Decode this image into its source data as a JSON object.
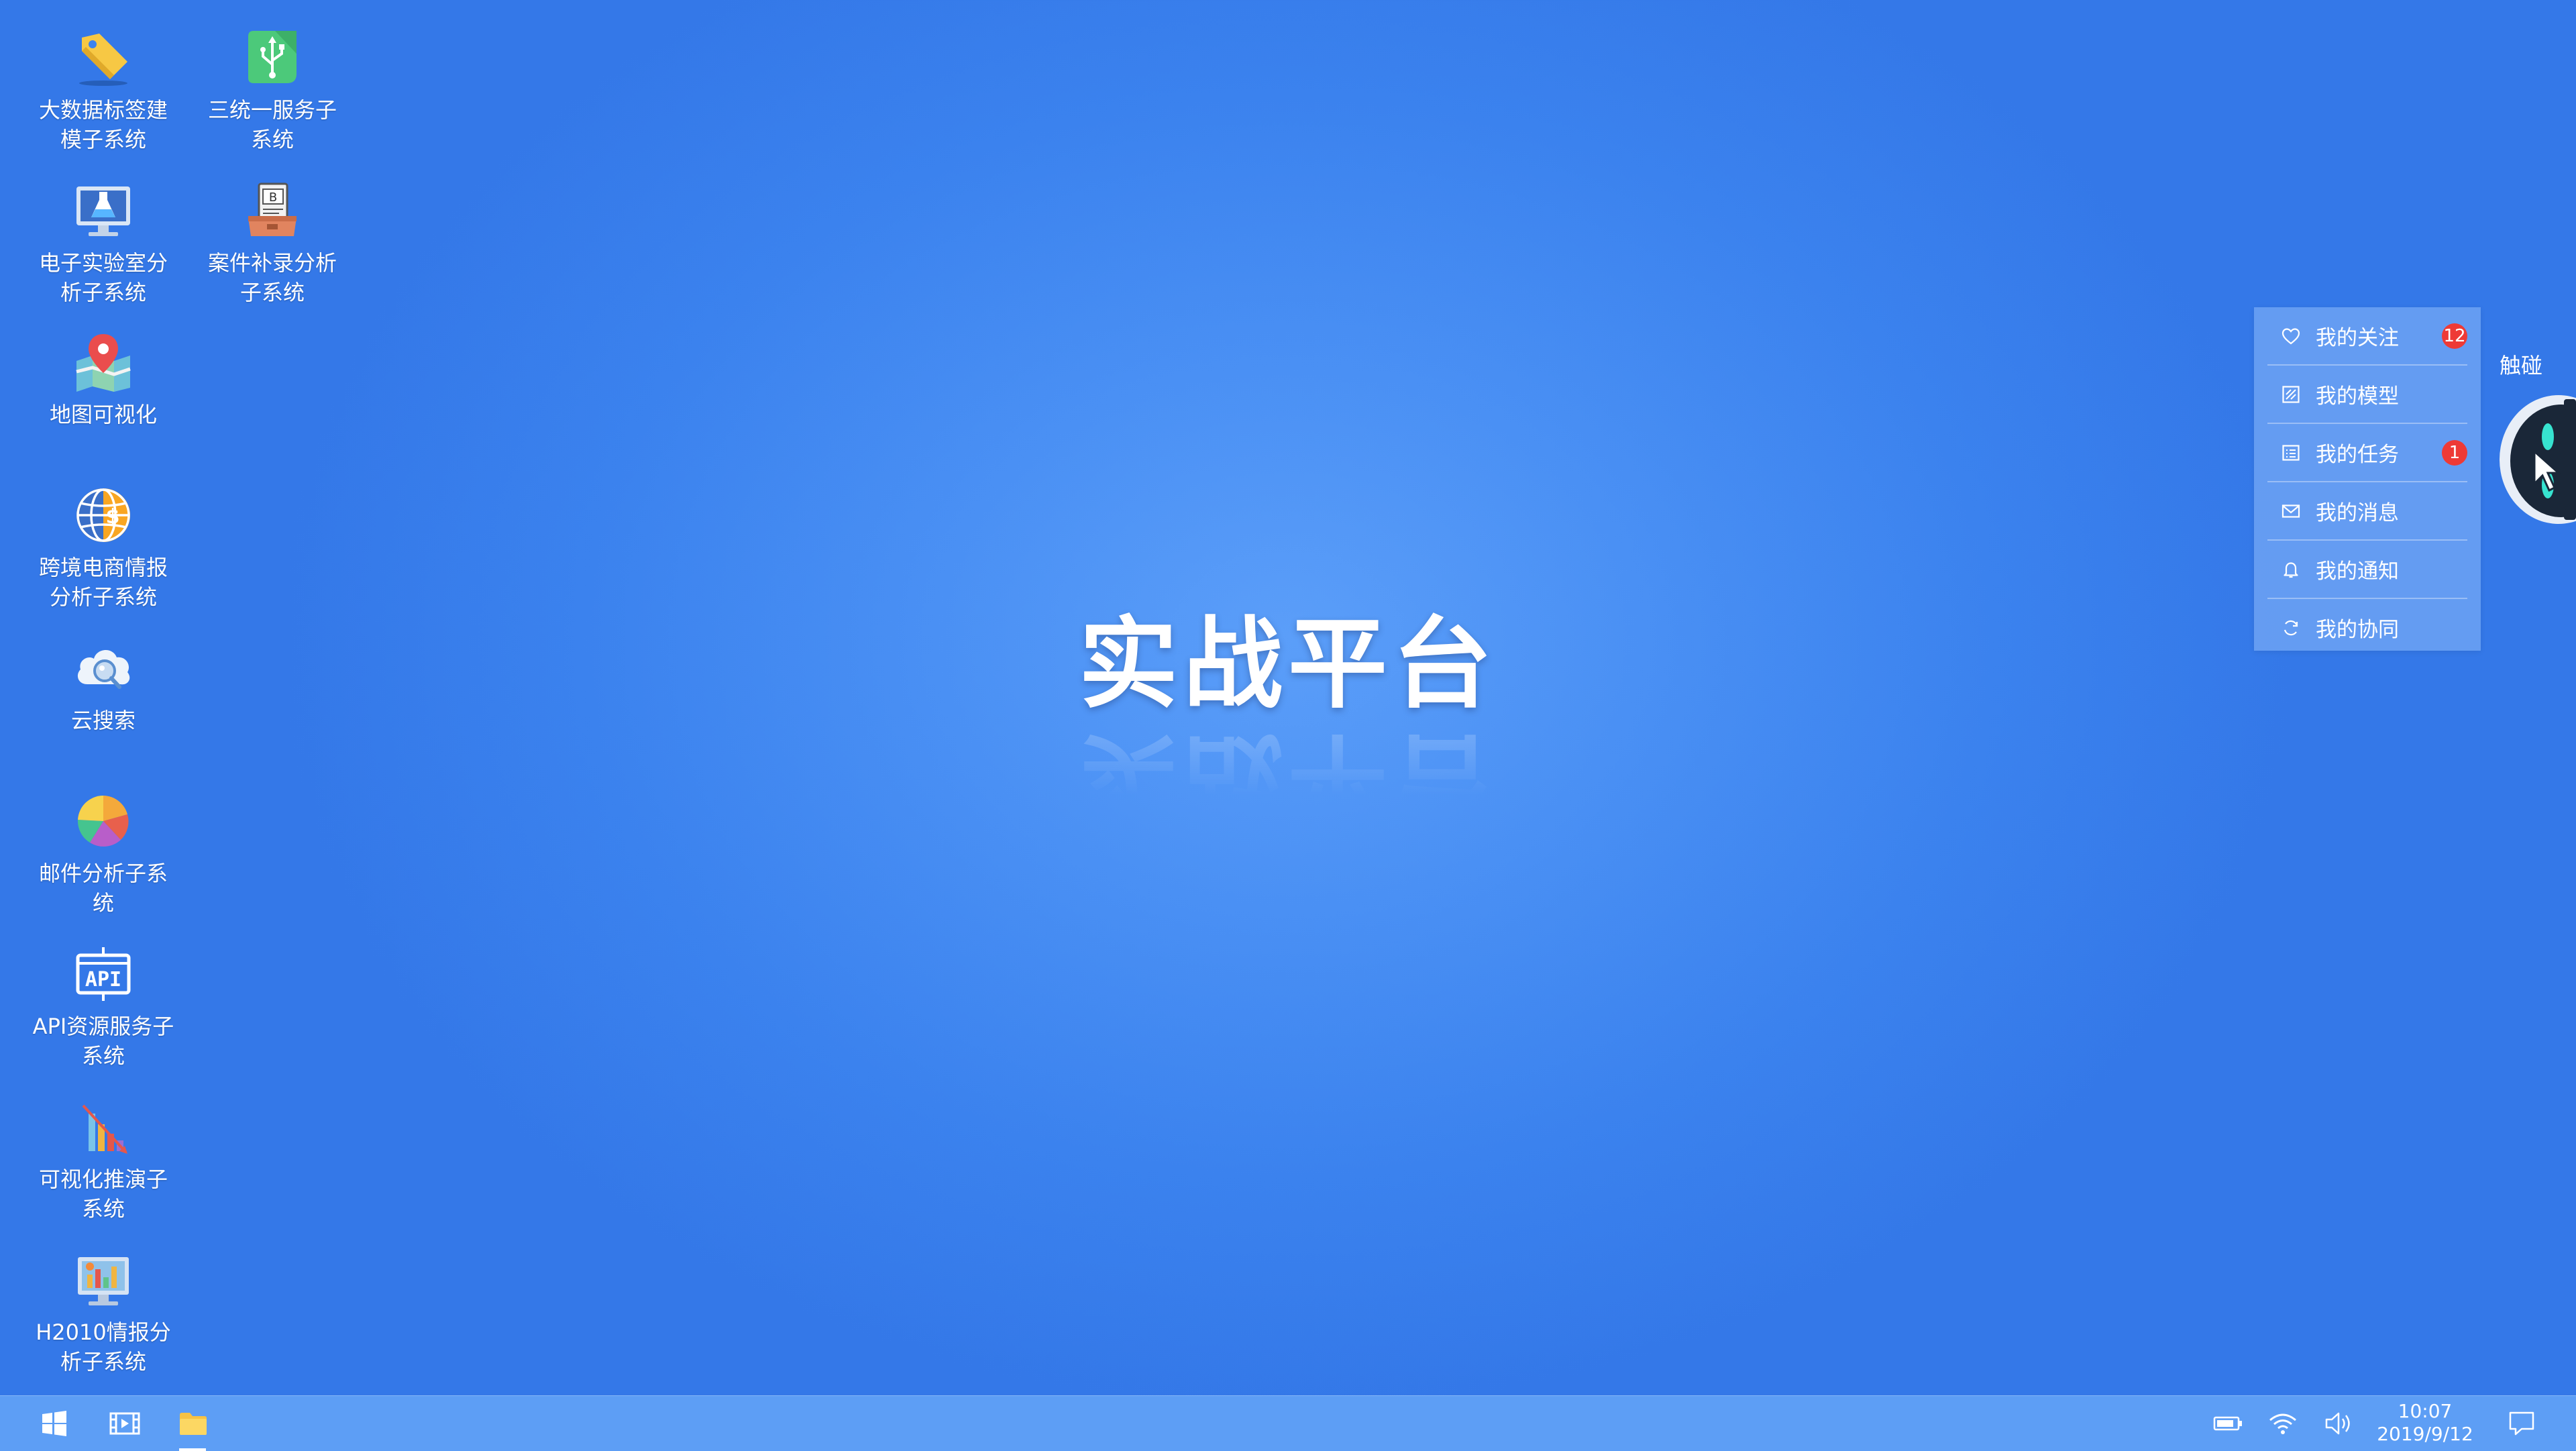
{
  "desktop": {
    "icons": [
      {
        "label": "大数据标签建模子系统",
        "icon": "tag-icon"
      },
      {
        "label": "三统一服务子系统",
        "icon": "usb-icon"
      },
      {
        "label": "电子实验室分析子系统",
        "icon": "flask-monitor-icon"
      },
      {
        "label": "案件补录分析子系统",
        "icon": "bitcoin-case-icon"
      },
      {
        "label": "地图可视化",
        "icon": "map-pin-icon"
      },
      {
        "label": "跨境电商情报分析子系统",
        "icon": "globe-coin-icon"
      },
      {
        "label": "云搜索",
        "icon": "cloud-search-icon"
      },
      {
        "label": "邮件分析子系统",
        "icon": "pie-chart-icon"
      },
      {
        "label": "API资源服务子系统",
        "icon": "api-icon"
      },
      {
        "label": "可视化推演子系统",
        "icon": "bar-trend-icon"
      },
      {
        "label": "H2010情报分析子系统",
        "icon": "monitor-chart-icon"
      }
    ],
    "title": "实战平台"
  },
  "panel": {
    "items": [
      {
        "label": "我的关注",
        "icon": "heart-icon",
        "badge": "12"
      },
      {
        "label": "我的模型",
        "icon": "model-icon",
        "badge": ""
      },
      {
        "label": "我的任务",
        "icon": "task-list-icon",
        "badge": "1"
      },
      {
        "label": "我的消息",
        "icon": "mail-icon",
        "badge": ""
      },
      {
        "label": "我的通知",
        "icon": "bell-icon",
        "badge": ""
      },
      {
        "label": "我的协同",
        "icon": "sync-icon",
        "badge": ""
      }
    ]
  },
  "assistant": {
    "label": "触碰",
    "icon": "assistant-robot-icon"
  },
  "taskbar": {
    "start": "windows-start-icon",
    "apps": [
      "video-player-icon",
      "file-explorer-icon"
    ],
    "tray": [
      "battery-icon",
      "wifi-icon",
      "volume-icon"
    ],
    "time": "10:07",
    "date": "2019/9/12",
    "notifications": "notification-icon"
  },
  "colors": {
    "background": "#3b82ee",
    "taskbar": "#5d9ef5",
    "badge": "#ee3a36",
    "panel": "#8cb9fa"
  }
}
